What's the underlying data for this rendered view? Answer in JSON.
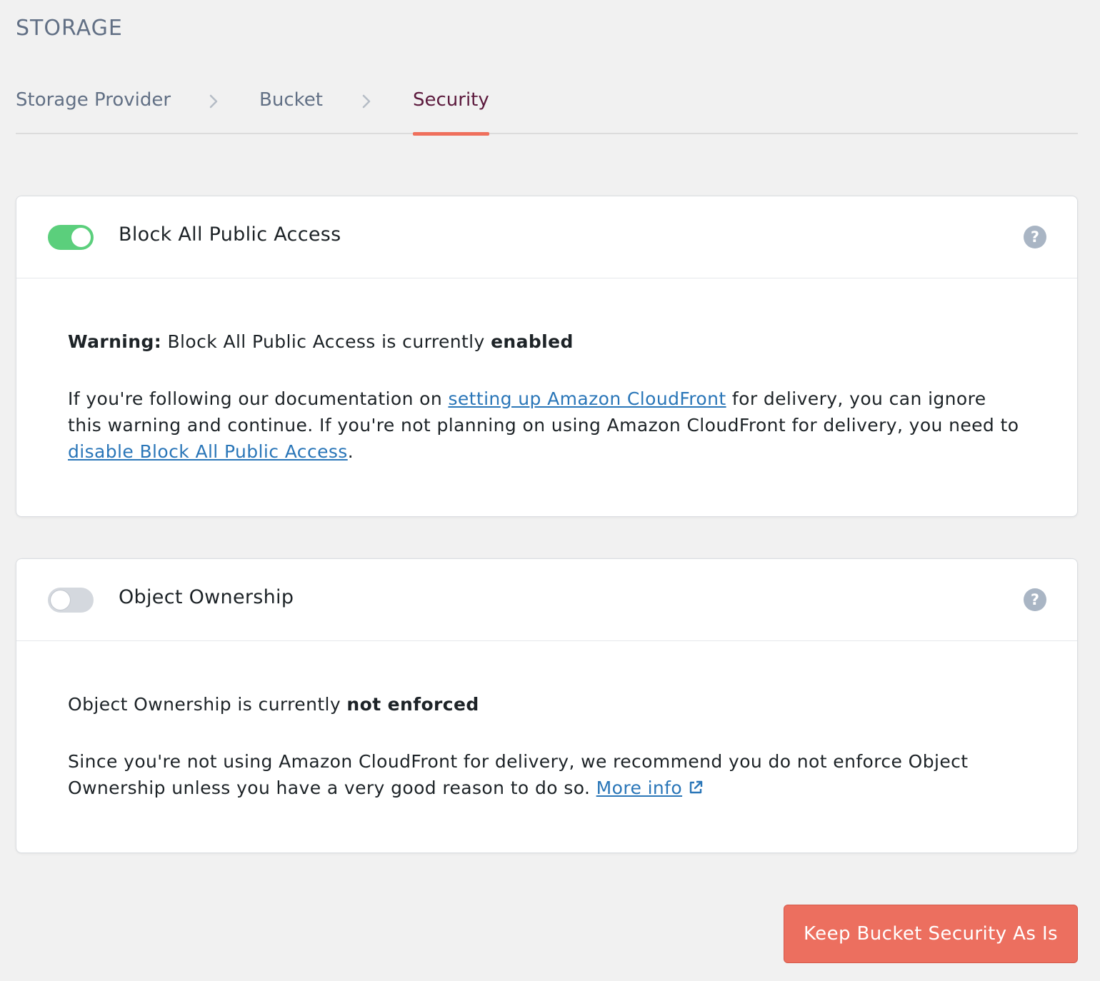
{
  "section": {
    "heading": "STORAGE"
  },
  "steps": [
    {
      "label": "Storage Provider",
      "active": false
    },
    {
      "label": "Bucket",
      "active": false
    },
    {
      "label": "Security",
      "active": true
    }
  ],
  "block_public_access": {
    "title": "Block All Public Access",
    "toggle": "on",
    "help_glyph": "?",
    "warning_label": "Warning:",
    "warning_text": " Block All Public Access is currently ",
    "warning_state": "enabled",
    "para_before_link": "If you're following our documentation on ",
    "link_cloudfront": "setting up Amazon CloudFront",
    "para_middle": " for delivery, you can ignore this warning and continue. If you're not planning on using Amazon CloudFront for delivery, you need to ",
    "link_disable": "disable Block All Public Access",
    "para_end": "."
  },
  "object_ownership": {
    "title": "Object Ownership",
    "toggle": "off",
    "help_glyph": "?",
    "status_text": "Object Ownership is currently ",
    "status_state": "not enforced",
    "para_text": "Since you're not using Amazon CloudFront for delivery, we recommend you do not enforce Object Ownership unless you have a very good reason to do so. ",
    "link_more": "More info",
    "link_icon": "external-link-icon"
  },
  "actions": {
    "primary_label": "Keep Bucket Security As Is"
  },
  "colors": {
    "accent": "#ef6f5c",
    "active_step": "#5c1a3d",
    "toggle_on": "#5bcf7c",
    "link": "#2a76b8",
    "button": "#ec6f5f"
  }
}
